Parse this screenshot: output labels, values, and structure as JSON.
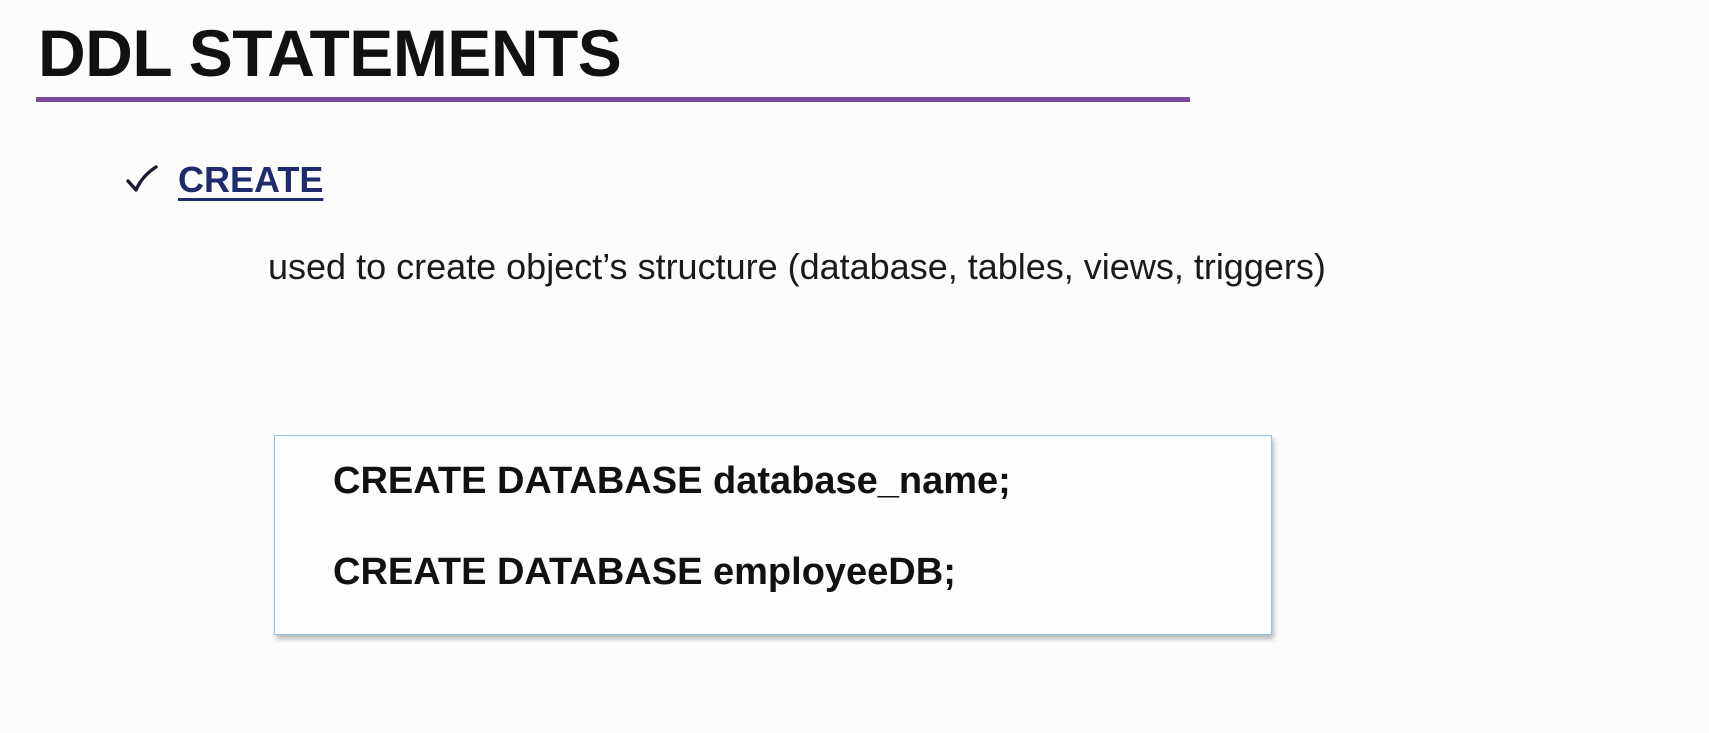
{
  "slide": {
    "title": "DDL STATEMENTS",
    "accent_color": "#7a4b9c",
    "bullet": {
      "icon": "check-icon",
      "label": "CREATE",
      "label_color": "#1f2b6e"
    },
    "description": "used to create object’s structure (database, tables, views, triggers)",
    "code_box": {
      "border_color": "#8ec3dd",
      "lines": [
        "CREATE DATABASE database_name;",
        "CREATE DATABASE employeeDB;"
      ]
    }
  }
}
